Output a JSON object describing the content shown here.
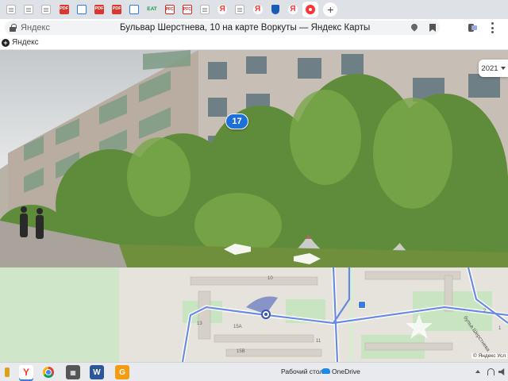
{
  "browser": {
    "tabs": [
      {
        "icon": "document-icon",
        "kind": "doc"
      },
      {
        "icon": "document-icon",
        "kind": "doc"
      },
      {
        "icon": "document-icon",
        "kind": "doc"
      },
      {
        "icon": "pdf-icon",
        "kind": "pdf",
        "text": "PDF"
      },
      {
        "icon": "mail-icon",
        "kind": "mail"
      },
      {
        "icon": "pdf-icon",
        "kind": "pdf",
        "text": "PDF"
      },
      {
        "icon": "pdf-icon",
        "kind": "pdf",
        "text": "PDF"
      },
      {
        "icon": "mail-icon",
        "kind": "mail"
      },
      {
        "icon": "eat-icon",
        "kind": "eat",
        "text": "EAT"
      },
      {
        "icon": "rgs-icon",
        "kind": "rgs",
        "text": "PFC"
      },
      {
        "icon": "rgs-icon",
        "kind": "rgs",
        "text": "PFC"
      },
      {
        "icon": "document-icon",
        "kind": "doc"
      },
      {
        "icon": "yandex-icon",
        "kind": "ya",
        "text": "Я"
      },
      {
        "icon": "document-icon",
        "kind": "doc"
      },
      {
        "icon": "yandex-icon",
        "kind": "ya",
        "text": "Я"
      },
      {
        "icon": "shield-icon",
        "kind": "shield"
      },
      {
        "icon": "yandex-icon",
        "kind": "ya",
        "text": "Я"
      },
      {
        "icon": "yandex-maps-icon",
        "kind": "map",
        "active": true
      }
    ],
    "new_tab_label": "+",
    "address": {
      "domain": "Яндекс",
      "title": "Бульвар Шерстнева, 10 на карте Воркуты — Яндекс Карты"
    },
    "bookmarks": {
      "item_label": "Яндекс"
    }
  },
  "panorama": {
    "year": "2021",
    "house_number": "17"
  },
  "minimap": {
    "labels": [
      {
        "text": "10"
      },
      {
        "text": "13"
      },
      {
        "text": "15A"
      },
      {
        "text": "15B"
      },
      {
        "text": "11"
      },
      {
        "text": "2"
      },
      {
        "text": "1"
      }
    ],
    "street_name": "бульв.Шерстнева",
    "copyright": "© Яндекс  Усл"
  },
  "taskbar": {
    "tray_text": "Рабочий стол",
    "onedrive_label": "OneDrive",
    "yandex_label": "Y"
  }
}
